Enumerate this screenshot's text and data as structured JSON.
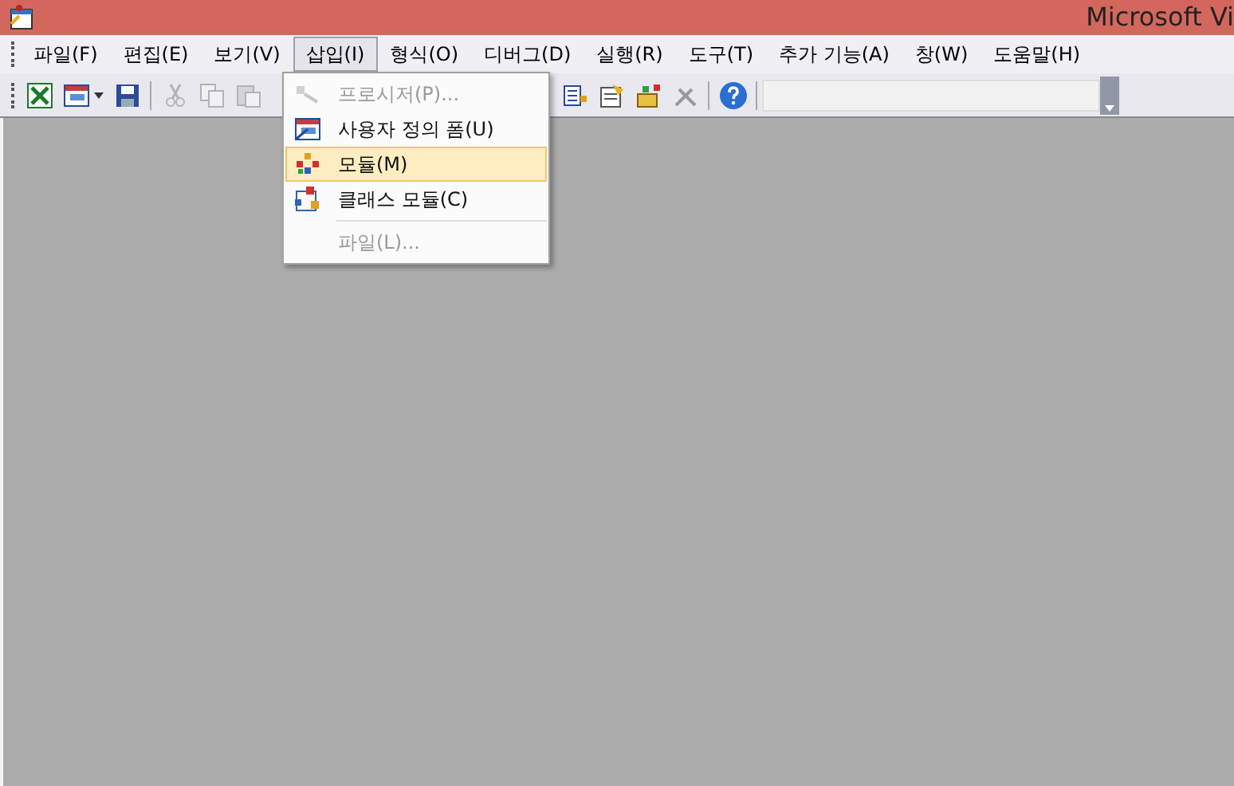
{
  "window": {
    "title": "Microsoft Vi"
  },
  "menu_bar": [
    {
      "label": "파일(F)",
      "selected": false
    },
    {
      "label": "편집(E)",
      "selected": false
    },
    {
      "label": "보기(V)",
      "selected": false
    },
    {
      "label": "삽입(I)",
      "selected": true
    },
    {
      "label": "형식(O)",
      "selected": false
    },
    {
      "label": "디버그(D)",
      "selected": false
    },
    {
      "label": "실행(R)",
      "selected": false
    },
    {
      "label": "도구(T)",
      "selected": false
    },
    {
      "label": "추가 기능(A)",
      "selected": false
    },
    {
      "label": "창(W)",
      "selected": false
    },
    {
      "label": "도움말(H)",
      "selected": false
    }
  ],
  "insert_menu": [
    {
      "label": "프로시저(P)...",
      "kind": "procedure",
      "disabled": true,
      "selected": false,
      "separator_before": false
    },
    {
      "label": "사용자 정의 폼(U)",
      "kind": "form",
      "disabled": false,
      "selected": false,
      "separator_before": false
    },
    {
      "label": "모듈(M)",
      "kind": "module",
      "disabled": false,
      "selected": true,
      "separator_before": false
    },
    {
      "label": "클래스 모듈(C)",
      "kind": "class",
      "disabled": false,
      "selected": false,
      "separator_before": false
    },
    {
      "label": "파일(L)...",
      "kind": "file",
      "disabled": true,
      "selected": false,
      "separator_before": true
    }
  ]
}
